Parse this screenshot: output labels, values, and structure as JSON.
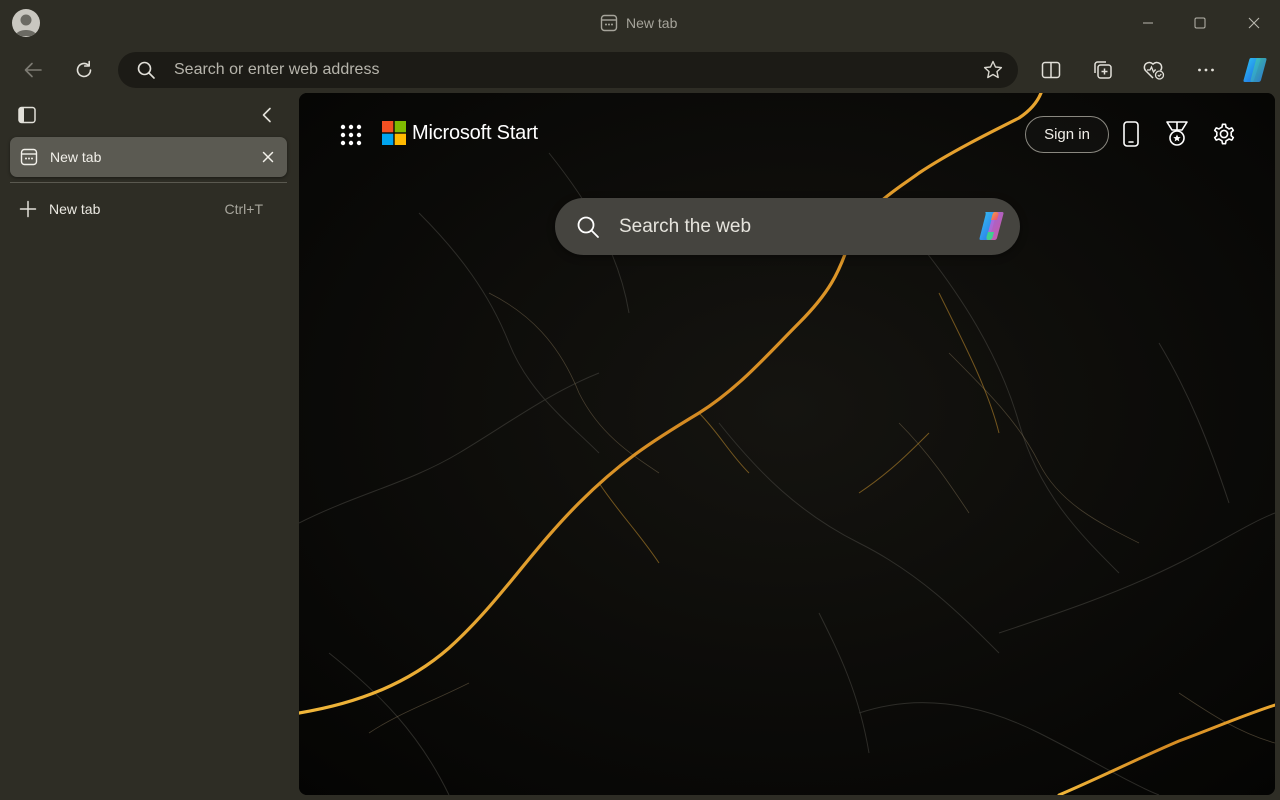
{
  "window": {
    "title": "New tab",
    "controls": [
      "minimize-icon",
      "maximize-icon",
      "close-icon"
    ]
  },
  "toolbar": {
    "address_placeholder": "Search or enter web address",
    "icons": [
      "back-icon",
      "refresh-icon",
      "search-icon",
      "favorite-star-icon",
      "split-screen-icon",
      "collections-icon",
      "browser-essentials-icon",
      "more-icon",
      "copilot-icon"
    ]
  },
  "sidebar": {
    "tabs": [
      {
        "label": "New tab",
        "active": true
      }
    ],
    "new_tab": {
      "label": "New tab",
      "shortcut": "Ctrl+T"
    }
  },
  "start_page": {
    "brand": "Microsoft Start",
    "sign_in_label": "Sign in",
    "search_placeholder": "Search the web",
    "icons": [
      "apps-grid-icon",
      "microsoft-logo-icon",
      "phone-icon",
      "rewards-icon",
      "settings-icon",
      "copilot-icon"
    ]
  },
  "colors": {
    "chrome_bg": "#2e2d25",
    "address_bg": "#1c1b16",
    "active_tab_bg": "#5b5a52",
    "search_box_bg": "#45443f",
    "marble_vein": "#d99a2b",
    "page_bg": "#050504"
  }
}
